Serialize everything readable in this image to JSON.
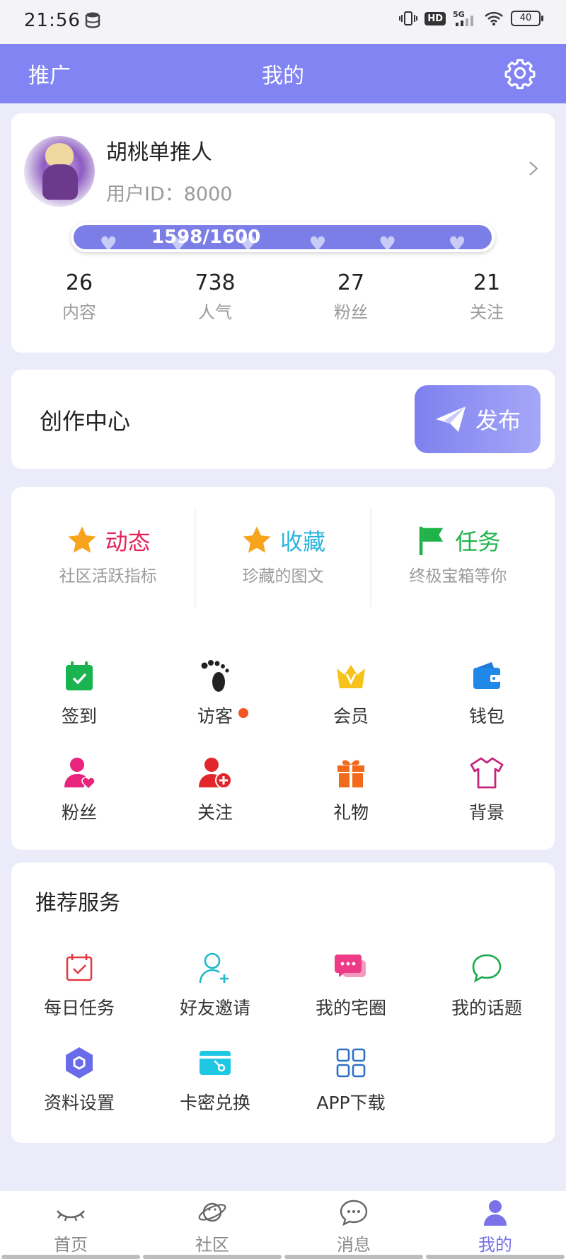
{
  "status_bar": {
    "time": "21:56",
    "hd": "HD",
    "network": "5G",
    "battery": "40"
  },
  "topbar": {
    "left_label": "推广",
    "title": "我的",
    "settings_icon": "gear-icon"
  },
  "profile": {
    "username": "胡桃单推人",
    "user_id": "用户ID：8000",
    "progress_text": "1598/1600",
    "progress_value": 0.999,
    "stats": [
      {
        "value": "26",
        "label": "内容"
      },
      {
        "value": "738",
        "label": "人气"
      },
      {
        "value": "27",
        "label": "粉丝"
      },
      {
        "value": "21",
        "label": "关注"
      }
    ]
  },
  "create_center": {
    "title": "创作中心",
    "publish_label": "发布",
    "publish_icon": "paper-plane-icon"
  },
  "highlights": [
    {
      "title": "动态",
      "subtitle": "社区活跃指标",
      "icon": "star-icon",
      "color": "#e5245b"
    },
    {
      "title": "收藏",
      "subtitle": "珍藏的图文",
      "icon": "star-icon",
      "color": "#2cb5e0"
    },
    {
      "title": "任务",
      "subtitle": "终极宝箱等你",
      "icon": "flag-icon",
      "color": "#1fb34a"
    }
  ],
  "features": [
    {
      "label": "签到",
      "icon": "calendar-check-icon"
    },
    {
      "label": "访客",
      "icon": "footprints-icon",
      "badge": true
    },
    {
      "label": "会员",
      "icon": "crown-icon"
    },
    {
      "label": "钱包",
      "icon": "wallet-icon"
    },
    {
      "label": "粉丝",
      "icon": "user-heart-icon"
    },
    {
      "label": "关注",
      "icon": "user-add-icon"
    },
    {
      "label": "礼物",
      "icon": "gift-icon"
    },
    {
      "label": "背景",
      "icon": "tshirt-icon"
    }
  ],
  "services": {
    "title": "推荐服务",
    "items": [
      {
        "label": "每日任务",
        "icon": "calendar-task-icon"
      },
      {
        "label": "好友邀请",
        "icon": "user-invite-icon"
      },
      {
        "label": "我的宅圈",
        "icon": "chat-bubbles-icon"
      },
      {
        "label": "我的话题",
        "icon": "chat-bubble-icon"
      },
      {
        "label": "资料设置",
        "icon": "hexagon-settings-icon"
      },
      {
        "label": "卡密兑换",
        "icon": "card-key-icon"
      },
      {
        "label": "APP下载",
        "icon": "grid-apps-icon"
      }
    ]
  },
  "tabbar": {
    "tabs": [
      {
        "label": "首页",
        "icon": "eye-closed-icon",
        "active": false
      },
      {
        "label": "社区",
        "icon": "planet-icon",
        "active": false
      },
      {
        "label": "消息",
        "icon": "message-icon",
        "active": false
      },
      {
        "label": "我的",
        "icon": "user-icon",
        "active": true
      }
    ]
  },
  "colors": {
    "accent": "#8284f3",
    "active_tab": "#7a73e8",
    "badge": "#f25722"
  }
}
